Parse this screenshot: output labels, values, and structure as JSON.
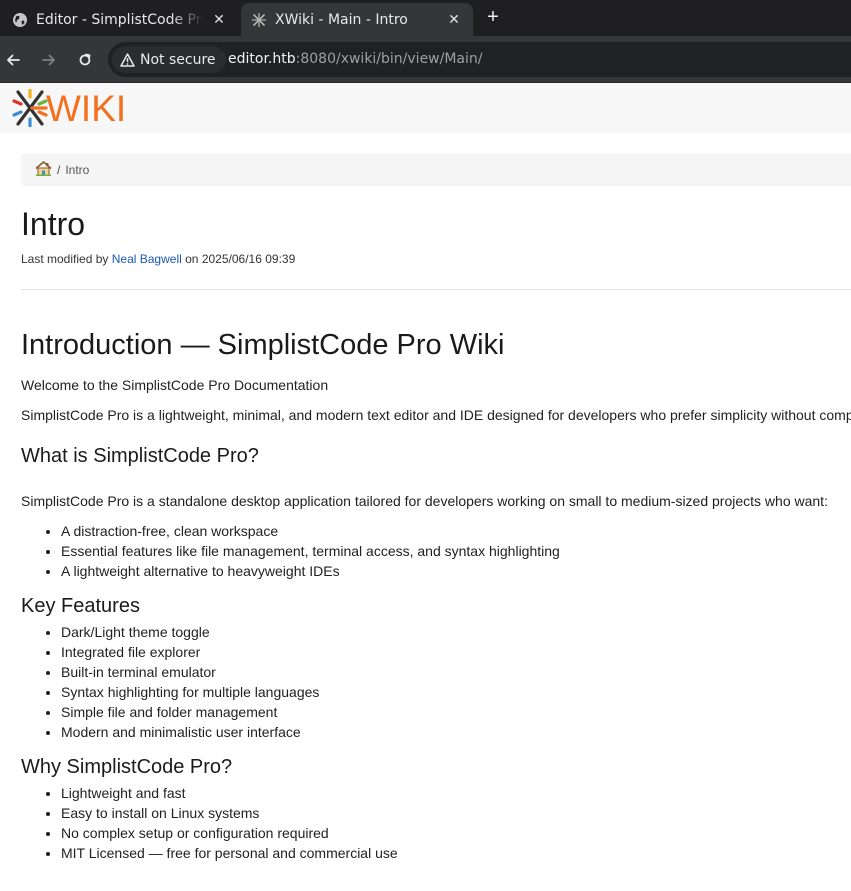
{
  "browser": {
    "tabs": [
      {
        "title": "Editor - SimplistCode Pro",
        "icon": "globe-icon",
        "active": false
      },
      {
        "title": "XWiki - Main - Intro",
        "icon": "xwiki-favicon",
        "active": true
      }
    ],
    "close_glyph": "✕",
    "new_tab_glyph": "+",
    "security_label": "Not secure",
    "url_host": "editor.htb",
    "url_rest": ":8080/xwiki/bin/view/Main/"
  },
  "xwiki": {
    "logo_text": "WIKI",
    "logo_colors": [
      "#f37021",
      "#3b8ed6",
      "#6bb33f",
      "#d9352b",
      "#f7b417",
      "#333333"
    ],
    "breadcrumb": {
      "separator": "/",
      "current": "Intro"
    },
    "page_title": "Intro",
    "modified": {
      "prefix": "Last modified by",
      "author": "Neal Bagwell",
      "middle": "on",
      "date": "2025/06/16 09:39"
    },
    "link_color": "#1a57b8"
  },
  "article": {
    "h1": "Introduction — SimplistCode Pro Wiki",
    "welcome": "Welcome to the SimplistCode Pro Documentation",
    "intro": "SimplistCode Pro is a lightweight, minimal, and modern text editor and IDE designed for developers who prefer simplicity without comp",
    "what_heading": "What is SimplistCode Pro?",
    "what_text": "SimplistCode Pro is a standalone desktop application tailored for developers working on small to medium-sized projects who want:",
    "what_items": [
      "A distraction-free, clean workspace",
      "Essential features like file management, terminal access, and syntax highlighting",
      "A lightweight alternative to heavyweight IDEs"
    ],
    "features_heading": "Key Features",
    "features_items": [
      "Dark/Light theme toggle",
      "Integrated file explorer",
      "Built-in terminal emulator",
      "Syntax highlighting for multiple languages",
      "Simple file and folder management",
      "Modern and minimalistic user interface"
    ],
    "why_heading": "Why SimplistCode Pro?",
    "why_items": [
      "Lightweight and fast",
      "Easy to install on Linux systems",
      "No complex setup or configuration required",
      "MIT Licensed — free for personal and commercial use"
    ]
  }
}
